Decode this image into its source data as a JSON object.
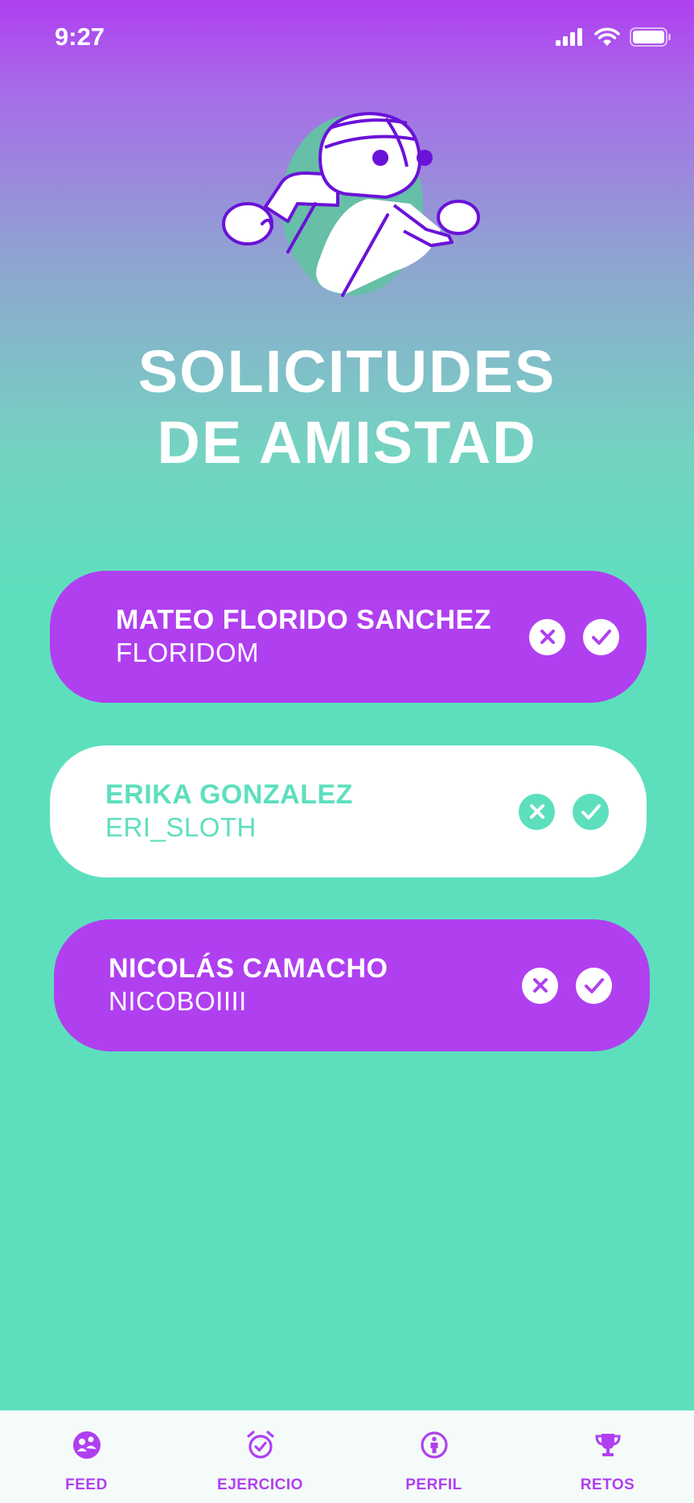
{
  "status_bar": {
    "time": "9:27"
  },
  "title": {
    "line1": "SOLICITUDES",
    "line2": "DE AMISTAD"
  },
  "requests": [
    {
      "full_name": "MATEO FLORIDO SANCHEZ",
      "username": "FLORIDOM"
    },
    {
      "full_name": "ERIKA GONZALEZ",
      "username": "ERI_SLOTH"
    },
    {
      "full_name": "NICOLÁS CAMACHO",
      "username": "NICOBOIIII"
    }
  ],
  "tabs": [
    {
      "label": "FEED",
      "icon": "feed-icon"
    },
    {
      "label": "EJERCICIO",
      "icon": "alarm-check-icon"
    },
    {
      "label": "PERFIL",
      "icon": "person-icon"
    },
    {
      "label": "RETOS",
      "icon": "trophy-icon"
    }
  ],
  "colors": {
    "purple": "#b03ff0",
    "mint": "#5ddfbe",
    "white": "#ffffff"
  }
}
